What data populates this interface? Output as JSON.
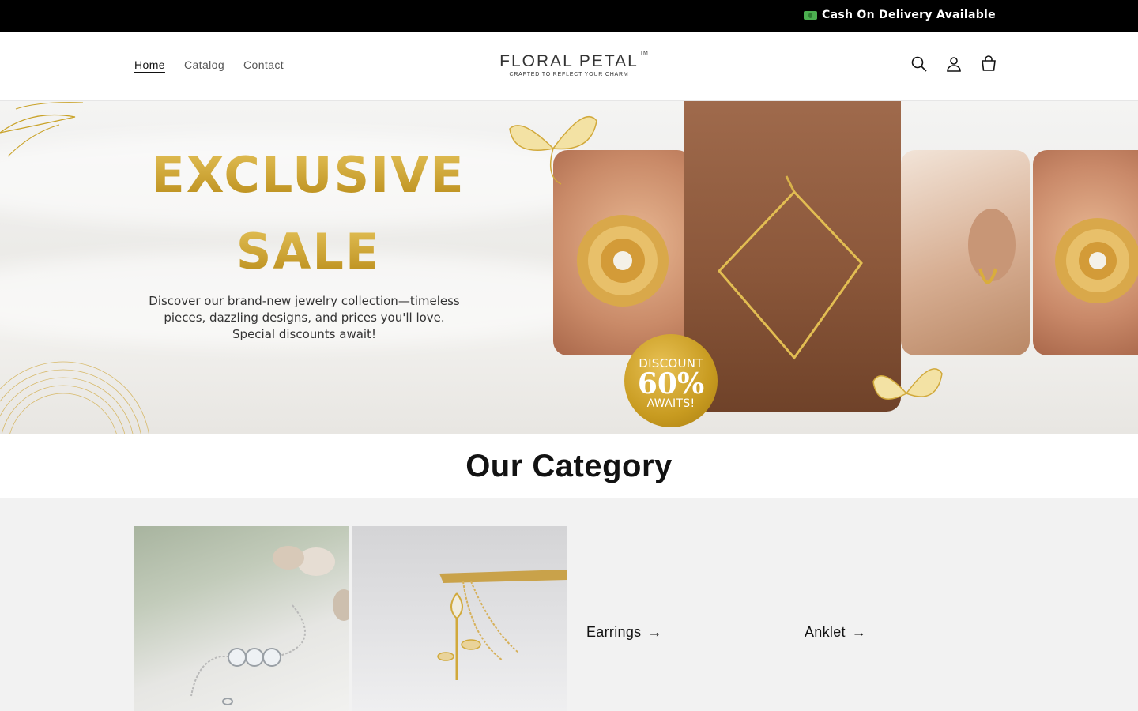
{
  "announcement": {
    "text": "Cash On Delivery Available",
    "icon": "cash-icon"
  },
  "header": {
    "nav": [
      {
        "label": "Home",
        "active": true
      },
      {
        "label": "Catalog",
        "active": false
      },
      {
        "label": "Contact",
        "active": false
      }
    ],
    "logo": {
      "name": "FLORAL PETAL",
      "tm": "TM",
      "tagline": "CRAFTED TO REFLECT YOUR CHARM"
    },
    "icons": [
      "search-icon",
      "account-icon",
      "cart-icon"
    ]
  },
  "hero": {
    "title_line1": "EXCLUSIVE",
    "title_line2": "SALE",
    "description": "Discover our brand-new jewelry collection—timeless pieces, dazzling designs, and prices you'll love. Special discounts await!",
    "badge": {
      "line1": "DISCOUNT",
      "line2": "60%",
      "line3": "AWAITS!"
    },
    "accent_color": "#c9a227"
  },
  "category": {
    "heading": "Our Category",
    "links": [
      {
        "label": "Earrings",
        "arrow": "→"
      },
      {
        "label": "Anklet",
        "arrow": "→"
      }
    ]
  }
}
